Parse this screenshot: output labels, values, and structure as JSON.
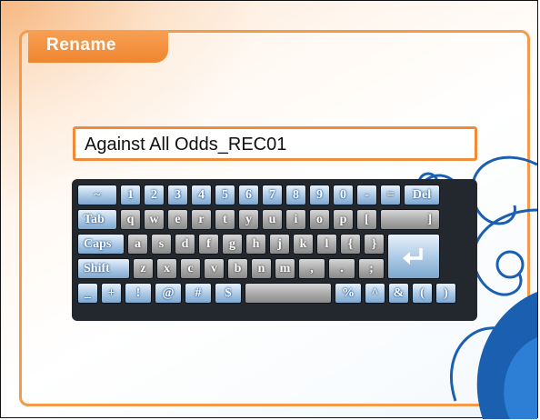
{
  "dialog": {
    "title": "Rename"
  },
  "name_field": {
    "value": "Against All Odds_REC01"
  },
  "keyboard": {
    "row1": [
      "~",
      "1",
      "2",
      "3",
      "4",
      "5",
      "6",
      "7",
      "8",
      "9",
      "0",
      "-",
      "=",
      "Del"
    ],
    "row2": [
      "Tab",
      "q",
      "w",
      "e",
      "r",
      "t",
      "y",
      "u",
      "i",
      "o",
      "p",
      "[",
      "]"
    ],
    "row3": [
      "Caps",
      "a",
      "s",
      "d",
      "f",
      "g",
      "h",
      "j",
      "k",
      "l",
      "{",
      "}"
    ],
    "row4": [
      "Shift",
      "z",
      "x",
      "c",
      "v",
      "b",
      "n",
      "m",
      ",",
      ".",
      ";"
    ],
    "row5": [
      "_",
      "+",
      "!",
      "@",
      "#",
      "$",
      "",
      "%",
      "^",
      "&",
      "(",
      ")"
    ],
    "enter_icon": "enter-arrow-icon"
  },
  "colors": {
    "accent": "#f39b4a",
    "key_blue": "#aac8e4",
    "key_gray": "#a9a9a9",
    "keyboard_bg": "#23272e"
  }
}
